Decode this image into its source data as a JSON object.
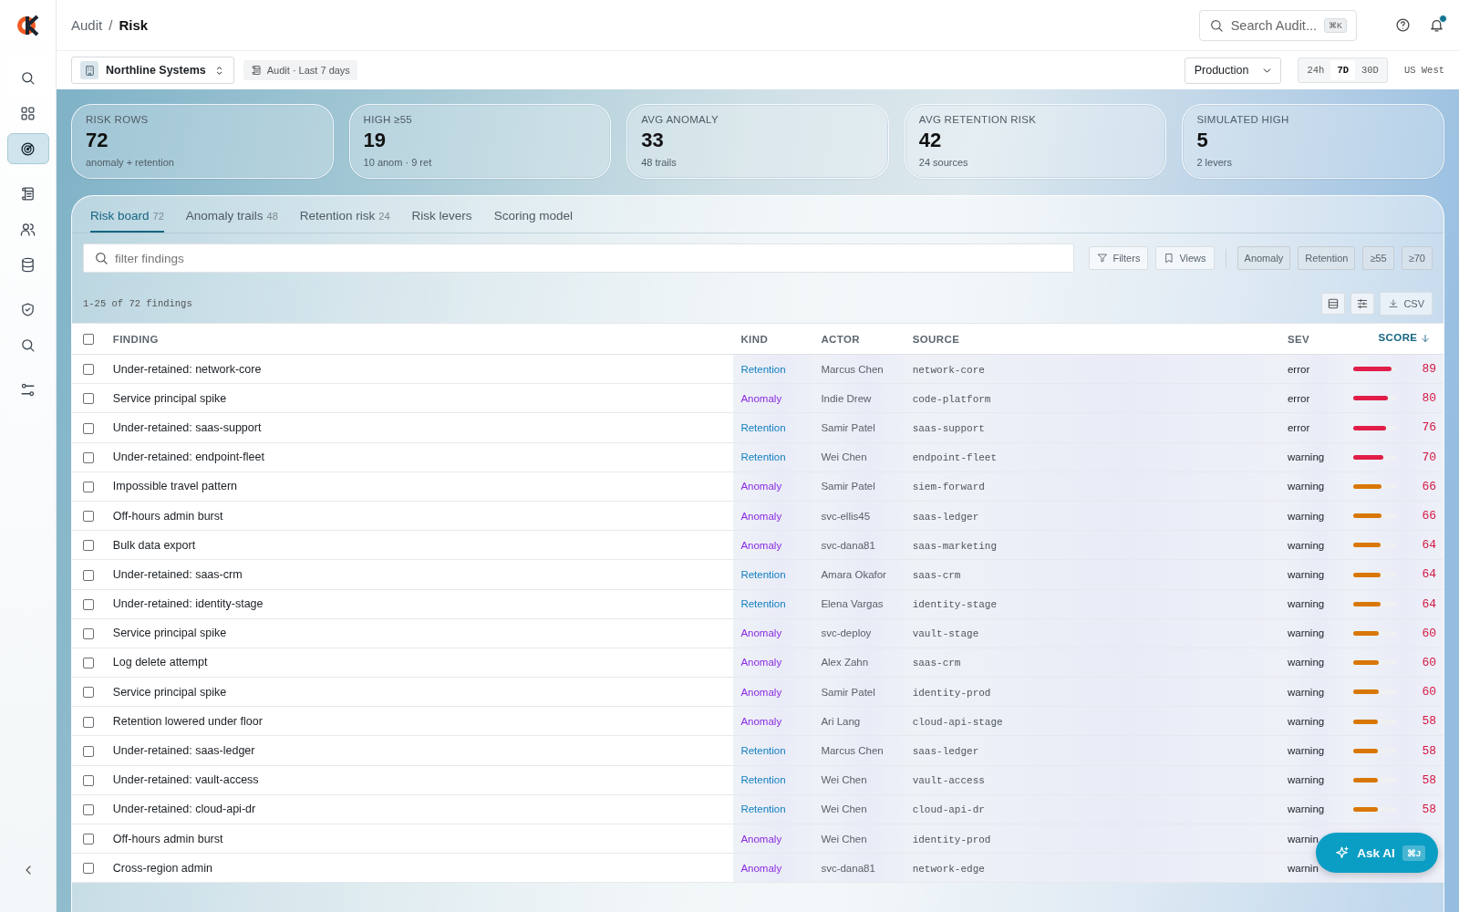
{
  "sidebar": {
    "items": [
      {
        "selected": false
      },
      {
        "selected": false
      },
      {
        "selected": true
      },
      {
        "selected": false
      },
      {
        "selected": false
      },
      {
        "selected": false
      },
      {
        "selected": false
      },
      {
        "selected": false
      },
      {
        "selected": false
      }
    ]
  },
  "breadcrumb": [
    "Audit",
    "Risk"
  ],
  "breadcrumb_separator": "/",
  "select_all": {
    "checked": false
  },
  "search": {
    "placeholder": "Search Audit...",
    "shortcut": "⌘K"
  },
  "notifications": {
    "unread": true
  },
  "workspace": {
    "name": "Northline Systems",
    "scope": "Audit · Last 7 days"
  },
  "environment": "Production",
  "ranges": [
    {
      "label": "24h",
      "selected": false
    },
    {
      "label": "7D",
      "selected": true
    },
    {
      "label": "30D",
      "selected": false
    }
  ],
  "region": "US West",
  "kpis": [
    {
      "label": "RISK ROWS",
      "value": "72",
      "note": "anomaly + retention"
    },
    {
      "label": "HIGH ≥55",
      "value": "19",
      "note": "10 anom · 9 ret"
    },
    {
      "label": "AVG ANOMALY",
      "value": "33",
      "note": "48 trails"
    },
    {
      "label": "AVG RETENTION RISK",
      "value": "42",
      "note": "24 sources"
    },
    {
      "label": "SIMULATED HIGH",
      "value": "5",
      "note": "2 levers"
    }
  ],
  "tabs": [
    {
      "label": "Risk board",
      "count": "72",
      "selected": true
    },
    {
      "label": "Anomaly trails",
      "count": "48",
      "selected": false
    },
    {
      "label": "Retention risk",
      "count": "24",
      "selected": false
    },
    {
      "label": "Risk levers",
      "selected": false
    },
    {
      "label": "Scoring model",
      "selected": false
    }
  ],
  "filter": {
    "placeholder": "filter findings"
  },
  "filter_buttons": [
    "Filters",
    "Views"
  ],
  "chips": [
    "Anomaly",
    "Retention",
    "≥55",
    "≥70"
  ],
  "results": "1-25 of 72 findings",
  "export": "CSV",
  "table": {
    "columns": [
      {
        "label": "FINDING",
        "sorted": false
      },
      {
        "label": "KIND",
        "sorted": false
      },
      {
        "label": "ACTOR",
        "sorted": false
      },
      {
        "label": "SOURCE",
        "sorted": false
      },
      {
        "label": "SEV",
        "sorted": false
      },
      {
        "label": "SCORE",
        "sorted": true
      }
    ],
    "rows": [
      {
        "checked": false,
        "finding": "Under-retained: network-core",
        "kind": "Retention",
        "actor": "Marcus Chen",
        "source": "network-core",
        "sev": "error",
        "score": "89",
        "level": 0.89
      },
      {
        "checked": false,
        "finding": "Service principal spike",
        "kind": "Anomaly",
        "actor": "Indie Drew",
        "source": "code-platform",
        "sev": "error",
        "score": "80",
        "level": 0.8
      },
      {
        "checked": false,
        "finding": "Under-retained: saas-support",
        "kind": "Retention",
        "actor": "Samir Patel",
        "source": "saas-support",
        "sev": "error",
        "score": "76",
        "level": 0.76
      },
      {
        "checked": false,
        "finding": "Under-retained: endpoint-fleet",
        "kind": "Retention",
        "actor": "Wei Chen",
        "source": "endpoint-fleet",
        "sev": "warning",
        "score": "70",
        "level": 0.7
      },
      {
        "checked": false,
        "finding": "Impossible travel pattern",
        "kind": "Anomaly",
        "actor": "Samir Patel",
        "source": "siem-forward",
        "sev": "warning",
        "score": "66",
        "level": 0.66
      },
      {
        "checked": false,
        "finding": "Off-hours admin burst",
        "kind": "Anomaly",
        "actor": "svc-ellis45",
        "source": "saas-ledger",
        "sev": "warning",
        "score": "66",
        "level": 0.66
      },
      {
        "checked": false,
        "finding": "Bulk data export",
        "kind": "Anomaly",
        "actor": "svc-dana81",
        "source": "saas-marketing",
        "sev": "warning",
        "score": "64",
        "level": 0.64
      },
      {
        "checked": false,
        "finding": "Under-retained: saas-crm",
        "kind": "Retention",
        "actor": "Amara Okafor",
        "source": "saas-crm",
        "sev": "warning",
        "score": "64",
        "level": 0.64
      },
      {
        "checked": false,
        "finding": "Under-retained: identity-stage",
        "kind": "Retention",
        "actor": "Elena Vargas",
        "source": "identity-stage",
        "sev": "warning",
        "score": "64",
        "level": 0.64
      },
      {
        "checked": false,
        "finding": "Service principal spike",
        "kind": "Anomaly",
        "actor": "svc-deploy",
        "source": "vault-stage",
        "sev": "warning",
        "score": "60",
        "level": 0.6
      },
      {
        "checked": false,
        "finding": "Log delete attempt",
        "kind": "Anomaly",
        "actor": "Alex Zahn",
        "source": "saas-crm",
        "sev": "warning",
        "score": "60",
        "level": 0.6
      },
      {
        "checked": false,
        "finding": "Service principal spike",
        "kind": "Anomaly",
        "actor": "Samir Patel",
        "source": "identity-prod",
        "sev": "warning",
        "score": "60",
        "level": 0.6
      },
      {
        "checked": false,
        "finding": "Retention lowered under floor",
        "kind": "Anomaly",
        "actor": "Ari Lang",
        "source": "cloud-api-stage",
        "sev": "warning",
        "score": "58",
        "level": 0.58
      },
      {
        "checked": false,
        "finding": "Under-retained: saas-ledger",
        "kind": "Retention",
        "actor": "Marcus Chen",
        "source": "saas-ledger",
        "sev": "warning",
        "score": "58",
        "level": 0.58
      },
      {
        "checked": false,
        "finding": "Under-retained: vault-access",
        "kind": "Retention",
        "actor": "Wei Chen",
        "source": "vault-access",
        "sev": "warning",
        "score": "58",
        "level": 0.58
      },
      {
        "checked": false,
        "finding": "Under-retained: cloud-api-dr",
        "kind": "Retention",
        "actor": "Wei Chen",
        "source": "cloud-api-dr",
        "sev": "warning",
        "score": "58",
        "level": 0.58
      },
      {
        "checked": false,
        "finding": "Off-hours admin burst",
        "kind": "Anomaly",
        "actor": "Wei Chen",
        "source": "identity-prod",
        "sev": "warnin"
      },
      {
        "checked": false,
        "finding": "Cross-region admin",
        "kind": "Anomaly",
        "actor": "svc-dana81",
        "source": "network-edge",
        "sev": "warnin"
      }
    ]
  },
  "assistant": {
    "label": "Ask AI",
    "shortcut": "⌘J"
  }
}
